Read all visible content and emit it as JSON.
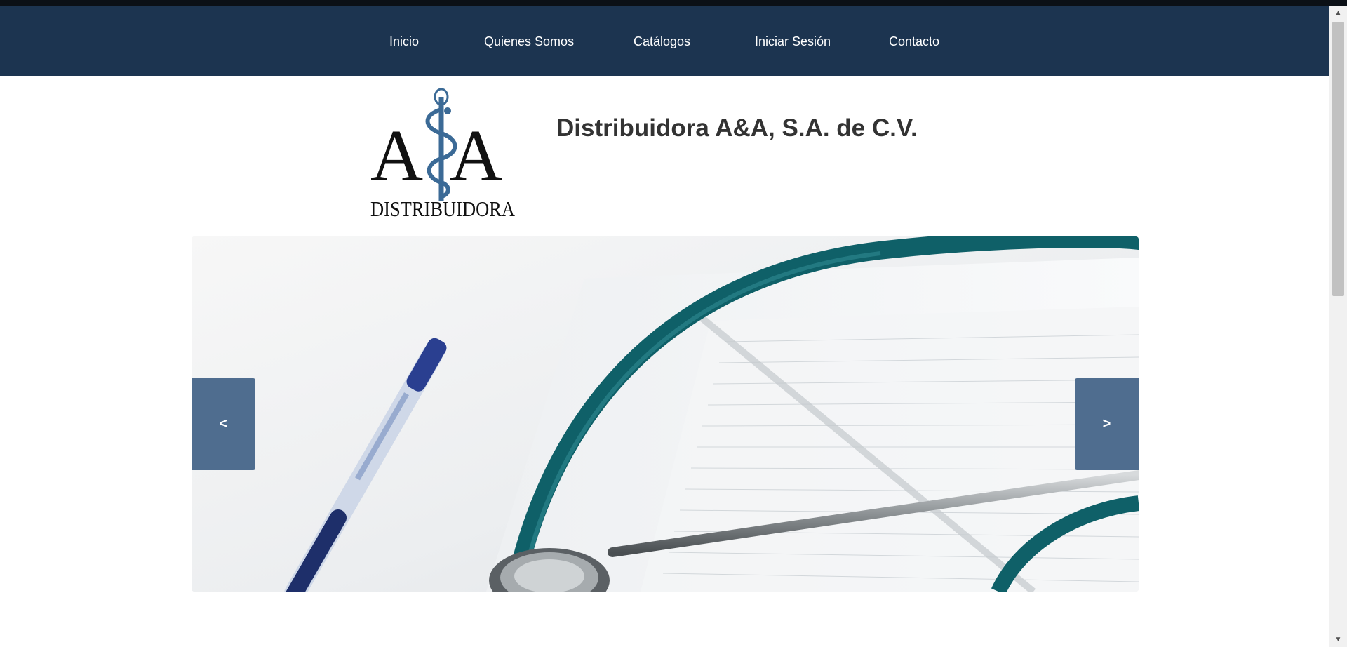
{
  "nav": {
    "items": [
      {
        "label": "Inicio"
      },
      {
        "label": "Quienes Somos"
      },
      {
        "label": "Catálogos"
      },
      {
        "label": "Iniciar Sesión"
      },
      {
        "label": "Contacto"
      }
    ]
  },
  "header": {
    "logo_text": "A&A DISTRIBUIDORA",
    "logo_word": "DISTRIBUIDORA",
    "title": "Distribuidora A&A, S.A. de C.V."
  },
  "slider": {
    "prev_label": "<",
    "next_label": ">"
  },
  "colors": {
    "navbar": "#1c3450",
    "slider_button": "#4f6d8f",
    "logo_accent": "#3b6a96"
  }
}
